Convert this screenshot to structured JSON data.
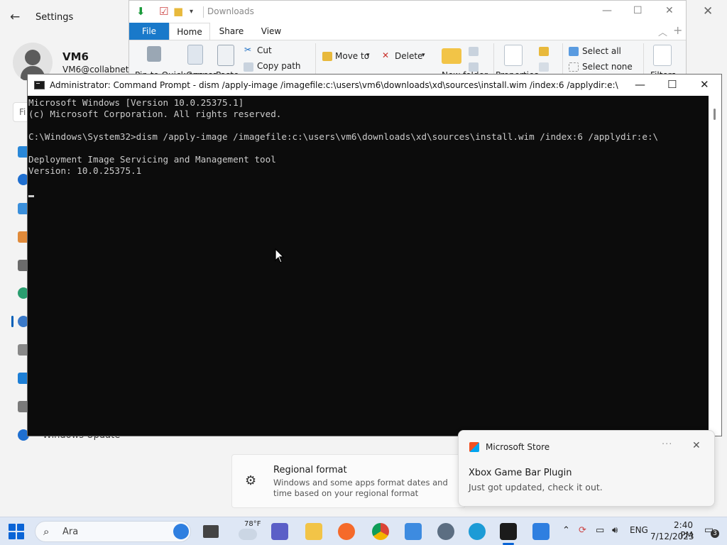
{
  "settings": {
    "title": "Settings",
    "user_name": "VM6",
    "user_email": "VM6@collabnet.local",
    "search_letters": "Fi",
    "nav_label": "Windows Update",
    "card_title": "Regional format",
    "card_desc": "Windows and some apps format dates and time based on your regional format"
  },
  "explorer": {
    "title": "Downloads",
    "tabs": [
      "File",
      "Home",
      "Share",
      "View"
    ],
    "ribbon": {
      "pin": "Pin to Quick access",
      "copy": "Copy",
      "paste": "Paste",
      "cut": "Cut",
      "copy_path": "Copy path",
      "move_to": "Move to",
      "delete": "Delete",
      "new_folder": "New folder",
      "properties": "Properties",
      "select_all": "Select all",
      "select_none": "Select none",
      "filters": "Filters"
    }
  },
  "cmd": {
    "title": "Administrator:  Command Prompt - dism  /apply-image /imagefile:c:\\users\\vm6\\downloads\\xd\\sources\\install.wim /index:6 /applydir:e:\\",
    "lines": [
      "Microsoft Windows [Version 10.0.25375.1]",
      "(c) Microsoft Corporation. All rights reserved.",
      "",
      "C:\\Windows\\System32>dism /apply-image /imagefile:c:\\users\\vm6\\downloads\\xd\\sources\\install.wim /index:6 /applydir:e:\\",
      "",
      "Deployment Image Servicing and Management tool",
      "Version: 10.0.25375.1"
    ]
  },
  "toast": {
    "app": "Microsoft Store",
    "more": "···",
    "heading": "Xbox Game Bar Plugin",
    "body": "Just got updated, check it out."
  },
  "taskbar": {
    "search_text": "Ara",
    "weather_temp": "78°F",
    "language": "ENG",
    "time": "2:40 PM",
    "date": "7/12/2023",
    "notification_count": "3"
  },
  "colors": {
    "accent": "#0a64d6",
    "console_bg": "#0c0c0c",
    "console_fg": "#cccccc",
    "explorer_file_tab": "#1979ca"
  }
}
